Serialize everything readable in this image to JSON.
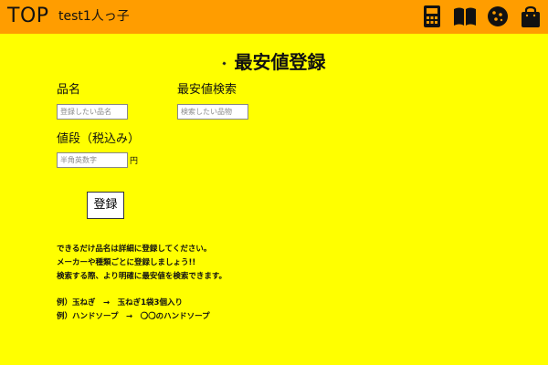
{
  "header": {
    "brand": "TOP",
    "username": "test1人っ子",
    "icons": [
      "calculator-icon",
      "book-icon",
      "cookie-icon",
      "shopping-bag-icon"
    ]
  },
  "page": {
    "title": "最安値登録"
  },
  "form": {
    "name_label": "品名",
    "name_placeholder": "登録したい品名",
    "search_label": "最安値検索",
    "search_placeholder": "検索したい品物",
    "price_label": "値段（税込み）",
    "price_placeholder": "半角英数字",
    "currency": "円",
    "submit_label": "登録"
  },
  "notes": {
    "line1": "できるだけ品名は詳細に登録してください。",
    "line2": "メーカーや種類ごとに登録しましょう!!",
    "line3": "検索する際、より明確に最安値を検索できます。",
    "example1": "例）玉ねぎ　→　玉ねぎ1袋3個入り",
    "example2": "例）ハンドソープ　→　〇〇のハンドソープ"
  },
  "colors": {
    "background": "#ffff00",
    "header": "#ff9d00"
  }
}
